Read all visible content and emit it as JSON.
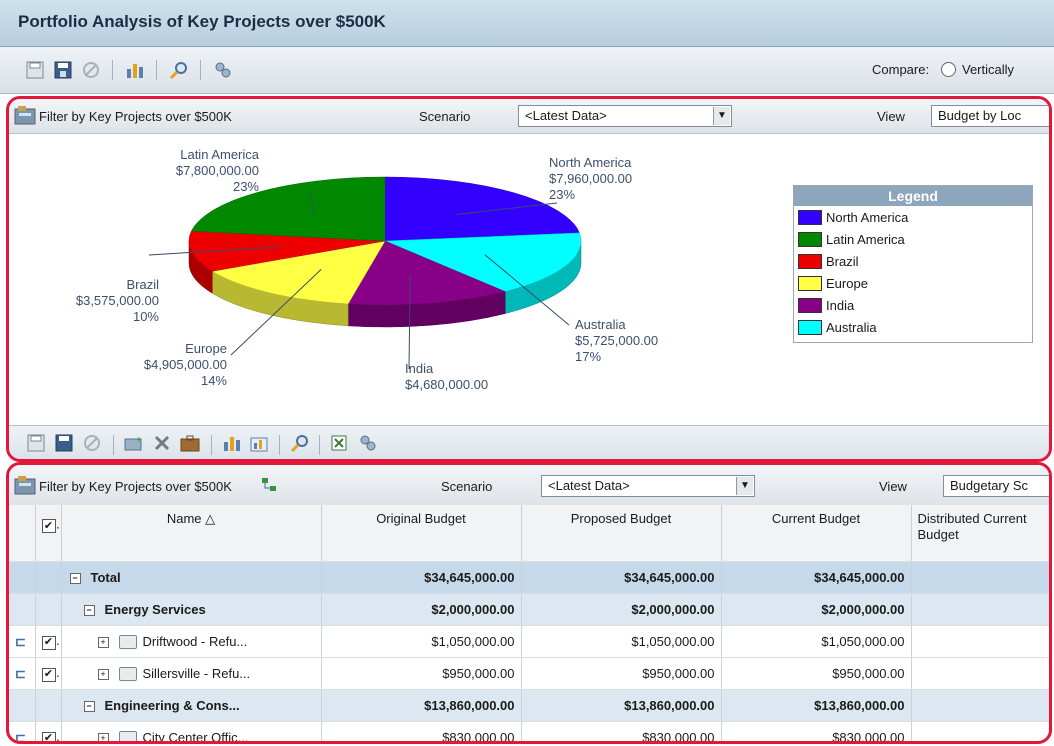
{
  "window": {
    "title": "Portfolio Analysis of Key Projects over $500K"
  },
  "toolbar": {
    "compare_label": "Compare:",
    "compare_option": "Vertically"
  },
  "top_panel": {
    "filter_label": "Filter by Key Projects over $500K",
    "scenario_label": "Scenario",
    "scenario_value": "<Latest Data>",
    "view_label": "View",
    "view_value": "Budget by Loc"
  },
  "chart_data": {
    "type": "pie",
    "title": "",
    "slices": [
      {
        "label": "North America",
        "value_text": "$7,960,000.00",
        "pct_text": "23%",
        "value": 7960000,
        "color": "#3300ff"
      },
      {
        "label": "Australia",
        "value_text": "$5,725,000.00",
        "pct_text": "17%",
        "value": 5725000,
        "color": "#00ffff"
      },
      {
        "label": "India",
        "value_text": "$4,680,000.00",
        "pct_text": "",
        "value": 4680000,
        "color": "#880088"
      },
      {
        "label": "Europe",
        "value_text": "$4,905,000.00",
        "pct_text": "14%",
        "value": 4905000,
        "color": "#ffff44"
      },
      {
        "label": "Brazil",
        "value_text": "$3,575,000.00",
        "pct_text": "10%",
        "value": 3575000,
        "color": "#ee0000"
      },
      {
        "label": "Latin America",
        "value_text": "$7,800,000.00",
        "pct_text": "23%",
        "value": 7800000,
        "color": "#008800"
      }
    ],
    "legend_title": "Legend",
    "legend_items": [
      {
        "label": "North America",
        "color": "#3300ff"
      },
      {
        "label": "Latin America",
        "color": "#008800"
      },
      {
        "label": "Brazil",
        "color": "#ee0000"
      },
      {
        "label": "Europe",
        "color": "#ffff44"
      },
      {
        "label": "India",
        "color": "#880088"
      },
      {
        "label": "Australia",
        "color": "#00ffff"
      }
    ]
  },
  "bottom_panel": {
    "filter_label": "Filter by Key Projects over $500K",
    "scenario_label": "Scenario",
    "scenario_value": "<Latest Data>",
    "view_label": "View",
    "view_value": "Budgetary Sc",
    "columns": {
      "name": "Name",
      "original": "Original Budget",
      "proposed": "Proposed Budget",
      "current": "Current Budget",
      "distributed": "Distributed Current Budget"
    },
    "rows": [
      {
        "name": "Total",
        "original": "$34,645,000.00",
        "proposed": "$34,645,000.00",
        "current": "$34,645,000.00"
      },
      {
        "name": "Energy Services",
        "original": "$2,000,000.00",
        "proposed": "$2,000,000.00",
        "current": "$2,000,000.00"
      },
      {
        "name": "Driftwood - Refu...",
        "original": "$1,050,000.00",
        "proposed": "$1,050,000.00",
        "current": "$1,050,000.00"
      },
      {
        "name": "Sillersville - Refu...",
        "original": "$950,000.00",
        "proposed": "$950,000.00",
        "current": "$950,000.00"
      },
      {
        "name": "Engineering & Cons...",
        "original": "$13,860,000.00",
        "proposed": "$13,860,000.00",
        "current": "$13,860,000.00"
      },
      {
        "name": "City Center Offic...",
        "original": "$830,000.00",
        "proposed": "$830,000.00",
        "current": "$830,000.00"
      }
    ]
  }
}
